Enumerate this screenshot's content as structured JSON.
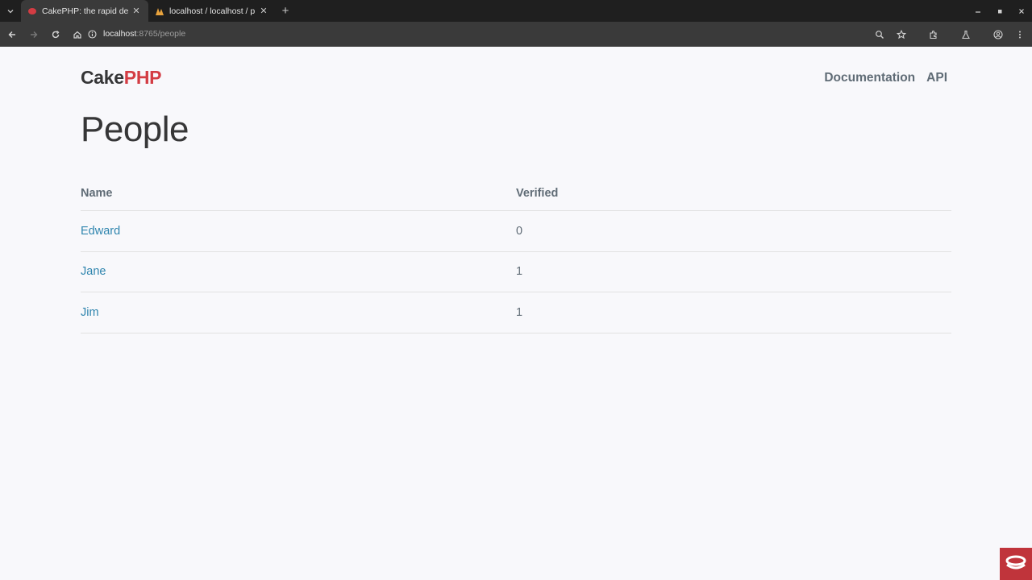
{
  "browser": {
    "tabs": [
      {
        "title": "CakePHP: the rapid de",
        "active": true
      },
      {
        "title": "localhost / localhost / p",
        "active": false
      }
    ],
    "url_host": "localhost",
    "url_path": ":8765/people"
  },
  "header": {
    "brand_cake": "Cake",
    "brand_php": "PHP",
    "nav": [
      "Documentation",
      "API"
    ]
  },
  "main": {
    "title": "People",
    "columns": [
      "Name",
      "Verified"
    ],
    "rows": [
      {
        "name": "Edward",
        "verified": "0"
      },
      {
        "name": "Jane",
        "verified": "1"
      },
      {
        "name": "Jim",
        "verified": "1"
      }
    ]
  },
  "colors": {
    "brand_red": "#d33c43",
    "link_blue": "#2f85ae",
    "text_gray": "#606c76"
  }
}
